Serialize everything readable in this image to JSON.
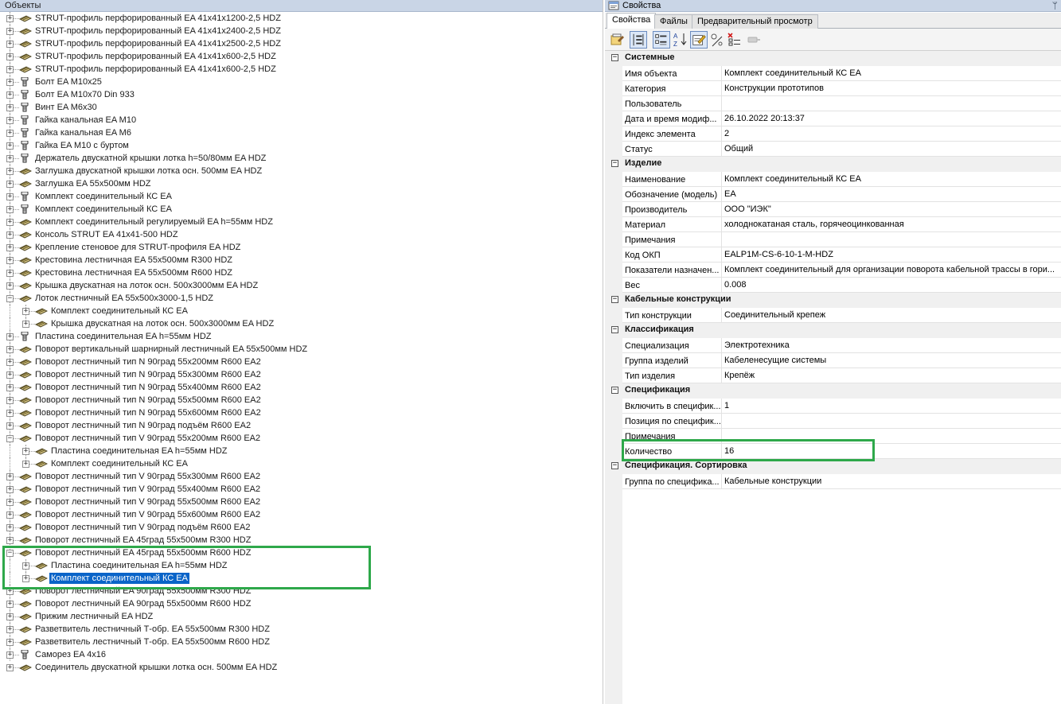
{
  "objects_panel": {
    "title": "Объекты",
    "tree": [
      {
        "label": "STRUT-профиль перфорированный EA 41x41x1200-2,5 HDZ",
        "icon": "profile"
      },
      {
        "label": "STRUT-профиль перфорированный EA 41x41x2400-2,5 HDZ",
        "icon": "profile"
      },
      {
        "label": "STRUT-профиль перфорированный EA 41x41x2500-2,5 HDZ",
        "icon": "profile"
      },
      {
        "label": "STRUT-профиль перфорированный EA 41x41x600-2,5 HDZ",
        "icon": "profile"
      },
      {
        "label": "STRUT-профиль перфорированный EA 41x41x600-2,5 HDZ",
        "icon": "profile"
      },
      {
        "label": "Болт EA M10x25",
        "icon": "bolt"
      },
      {
        "label": "Болт EA M10x70 Din  933",
        "icon": "bolt"
      },
      {
        "label": "Винт EA M6x30",
        "icon": "bolt"
      },
      {
        "label": "Гайка канальная EA M10",
        "icon": "bolt"
      },
      {
        "label": "Гайка канальная EA M6",
        "icon": "bolt"
      },
      {
        "label": "Гайка EA M10 с буртом",
        "icon": "bolt"
      },
      {
        "label": "Держатель двускатной крышки лотка h=50/80мм EA HDZ",
        "icon": "bolt"
      },
      {
        "label": "Заглушка двускатной крышки лотка осн. 500мм EA HDZ",
        "icon": "profile"
      },
      {
        "label": "Заглушка EA 55x500мм HDZ",
        "icon": "profile"
      },
      {
        "label": "Комплект соединительный КС EA",
        "icon": "bolt"
      },
      {
        "label": "Комплект соединительный КС EA",
        "icon": "bolt"
      },
      {
        "label": "Комплект соединительный регулируемый EA h=55мм HDZ",
        "icon": "profile"
      },
      {
        "label": "Консоль STRUT EA 41x41-500 HDZ",
        "icon": "profile"
      },
      {
        "label": "Крепление стеновое для STRUT-профиля EA HDZ",
        "icon": "profile"
      },
      {
        "label": "Крестовина лестничная EA 55x500мм R300 HDZ",
        "icon": "profile"
      },
      {
        "label": "Крестовина лестничная EA 55x500мм R600 HDZ",
        "icon": "profile"
      },
      {
        "label": "Крышка двускатная на лоток осн. 500x3000мм EA HDZ",
        "icon": "profile"
      },
      {
        "label": "Лоток лестничный EA 55x500x3000-1,5 HDZ",
        "icon": "profile",
        "expanded": true
      },
      {
        "label": "Комплект соединительный КС EA",
        "icon": "profile",
        "level": 1
      },
      {
        "label": "Крышка двускатная на лоток осн. 500x3000мм EA HDZ",
        "icon": "profile",
        "level": 1
      },
      {
        "label": "Пластина соединительная EA h=55мм HDZ",
        "icon": "bolt"
      },
      {
        "label": "Поворот вертикальный  шарнирный лестничный EA 55x500мм HDZ",
        "icon": "profile"
      },
      {
        "label": "Поворот лестничный тип N 90град  55x200мм R600 EA2",
        "icon": "profile"
      },
      {
        "label": "Поворот лестничный тип N 90град  55x300мм R600 EA2",
        "icon": "profile"
      },
      {
        "label": "Поворот лестничный тип N 90град  55x400мм R600 EA2",
        "icon": "profile"
      },
      {
        "label": "Поворот лестничный тип N 90град  55x500мм R600 EA2",
        "icon": "profile"
      },
      {
        "label": "Поворот лестничный тип N 90град  55x600мм R600 EA2",
        "icon": "profile"
      },
      {
        "label": "Поворот лестничный тип N 90град  подъём R600 EA2",
        "icon": "profile"
      },
      {
        "label": "Поворот лестничный тип V 90град  55x200мм R600 EA2",
        "icon": "profile",
        "expanded": true
      },
      {
        "label": "Пластина соединительная EA h=55мм HDZ",
        "icon": "profile",
        "level": 1
      },
      {
        "label": "Комплект соединительный КС EA",
        "icon": "profile",
        "level": 1
      },
      {
        "label": "Поворот лестничный тип V 90град  55x300мм R600 EA2",
        "icon": "profile"
      },
      {
        "label": "Поворот лестничный тип V 90град  55x400мм R600 EA2",
        "icon": "profile"
      },
      {
        "label": "Поворот лестничный тип V 90град  55x500мм R600 EA2",
        "icon": "profile"
      },
      {
        "label": "Поворот лестничный тип V 90град  55x600мм R600 EA2",
        "icon": "profile"
      },
      {
        "label": "Поворот лестничный тип V 90град  подъём R600 EA2",
        "icon": "profile"
      },
      {
        "label": "Поворот лестничный EA 45град 55x500мм R300 HDZ",
        "icon": "profile"
      },
      {
        "label": "Поворот лестничный EA 45град 55x500мм R600 HDZ",
        "icon": "profile",
        "expanded": true
      },
      {
        "label": "Пластина соединительная EA h=55мм HDZ",
        "icon": "profile",
        "level": 1
      },
      {
        "label": "Комплект соединительный КС EA",
        "icon": "profile",
        "level": 1,
        "selected": true
      },
      {
        "label": "Поворот лестничный EA 90град 55x500мм R300 HDZ",
        "icon": "profile"
      },
      {
        "label": "Поворот лестничный EA 90град 55x500мм R600 HDZ",
        "icon": "profile"
      },
      {
        "label": "Прижим лестничный EA HDZ",
        "icon": "profile"
      },
      {
        "label": "Разветвитель лестничный Т-обр. EA 55x500мм R300 HDZ",
        "icon": "profile"
      },
      {
        "label": "Разветвитель лестничный Т-обр. EA 55x500мм R600 HDZ",
        "icon": "profile"
      },
      {
        "label": "Саморез EA 4x16",
        "icon": "bolt"
      },
      {
        "label": "Соединитель двускатной крышки лотка осн. 500мм EA HDZ",
        "icon": "profile"
      }
    ]
  },
  "properties_panel": {
    "title": "Свойства",
    "pin_glyph": "ᛘ",
    "tabs": [
      "Свойства",
      "Файлы",
      "Предварительный просмотр"
    ],
    "active_tab": 0,
    "toolbar_icons": [
      "properties-page-icon",
      "sort-by-column-icon",
      "categorized-icon",
      "alphabetical-sort-icon",
      "edit-icon",
      "add-property-icon",
      "delete-property-icon",
      "disabled-action-icon"
    ],
    "categories": [
      {
        "name": "Системные",
        "rows": [
          {
            "name": "Имя объекта",
            "value": "Комплект соединительный КС EA"
          },
          {
            "name": "Категория",
            "value": "Конструкции прототипов"
          },
          {
            "name": "Пользователь",
            "value": ""
          },
          {
            "name": "Дата и время модиф...",
            "value": "26.10.2022 20:13:37"
          },
          {
            "name": "Индекс элемента",
            "value": "2"
          },
          {
            "name": "Статус",
            "value": "Общий"
          }
        ]
      },
      {
        "name": "Изделие",
        "rows": [
          {
            "name": "Наименование",
            "value": "Комплект соединительный КС EA"
          },
          {
            "name": "Обозначение (модель)",
            "value": "EA"
          },
          {
            "name": "Производитель",
            "value": "ООО \"ИЭК\""
          },
          {
            "name": "Материал",
            "value": "холоднокатаная сталь, горячеоцинкованная"
          },
          {
            "name": "Примечания",
            "value": ""
          },
          {
            "name": "Код ОКП",
            "value": "EALP1M-CS-6-10-1-M-HDZ"
          },
          {
            "name": "Показатели назначен...",
            "value": "Комплект соединительный для организации поворота кабельной трассы в гори..."
          },
          {
            "name": "Вес",
            "value": "0.008"
          }
        ]
      },
      {
        "name": "Кабельные конструкции",
        "rows": [
          {
            "name": "Тип конструкции",
            "value": "Соединительный крепеж"
          }
        ]
      },
      {
        "name": "Классификация",
        "rows": [
          {
            "name": "Специализация",
            "value": "Электротехника"
          },
          {
            "name": "Группа изделий",
            "value": "Кабеленесущие системы"
          },
          {
            "name": "Тип изделия",
            "value": "Крепёж"
          }
        ]
      },
      {
        "name": "Спецификация",
        "rows": [
          {
            "name": "Включить в специфик...",
            "value": "1"
          },
          {
            "name": "Позиция по специфик...",
            "value": ""
          },
          {
            "name": "Примечания",
            "value": ""
          },
          {
            "name": "Количество",
            "value": "16"
          }
        ]
      },
      {
        "name": "Спецификация. Сортировка",
        "rows": [
          {
            "name": "Группа по специфика...",
            "value": "Кабельные конструкции"
          }
        ]
      }
    ]
  },
  "colors": {
    "highlight_box": "#2ea84a",
    "selection": "#0a64c8",
    "header_bg": "#c9d5e6"
  }
}
